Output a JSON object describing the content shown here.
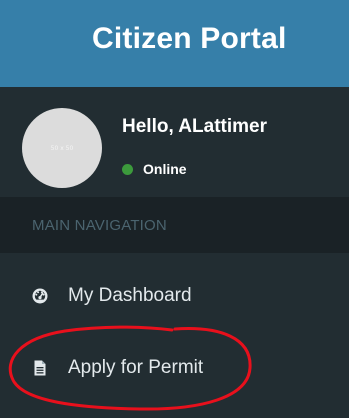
{
  "header": {
    "title": "Citizen Portal"
  },
  "user_panel": {
    "avatar_placeholder": "50 x 50",
    "greeting": "Hello, ALattimer",
    "status_label": "Online",
    "status_color": "#3c9a3c"
  },
  "navigation": {
    "header": "MAIN NAVIGATION",
    "items": [
      {
        "label": "My Dashboard",
        "icon": "dashboard-icon"
      },
      {
        "label": "Apply for Permit",
        "icon": "document-icon"
      }
    ]
  },
  "annotation": {
    "shape": "freehand-ellipse",
    "color": "#e8101c"
  },
  "colors": {
    "header_bg": "#367fa9",
    "sidebar_bg": "#222d32",
    "nav_header_bg": "#1a2226"
  }
}
